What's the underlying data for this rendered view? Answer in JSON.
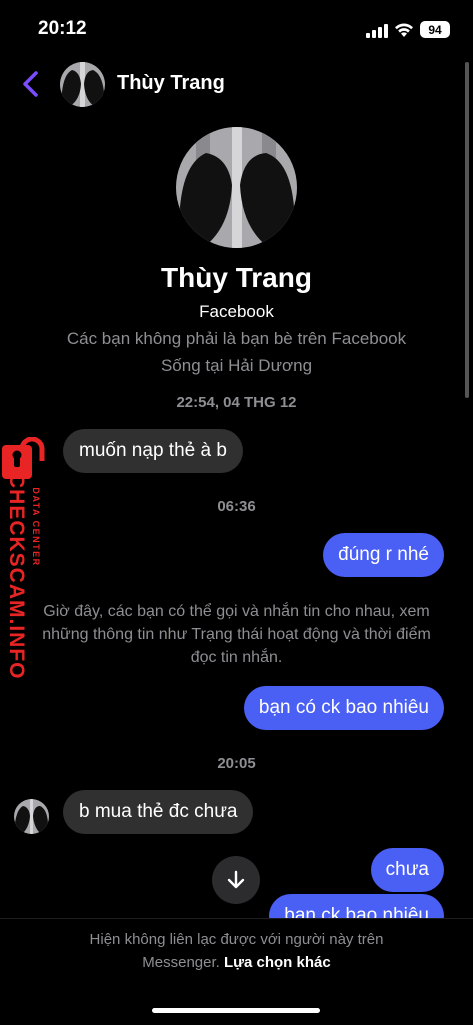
{
  "status_bar": {
    "time": "20:12",
    "battery": "94"
  },
  "header": {
    "contact_name": "Thùy Trang"
  },
  "profile": {
    "name": "Thùy Trang",
    "source": "Facebook",
    "relation": "Các bạn không phải là bạn bè trên Facebook",
    "location": "Sống tại Hải Dương"
  },
  "messages": {
    "ts1": "22:54, 04 THG 12",
    "m1": "muốn nạp thẻ à b",
    "ts2": "06:36",
    "m2": "đúng r nhé",
    "system_line1": "Giờ đây, các bạn có thể gọi và nhắn tin cho nhau, xem",
    "system_line2": "những thông tin như Trạng thái hoạt động và thời điểm",
    "system_line3": "đọc tin nhắn.",
    "m3": "bạn có ck bao nhiêu",
    "ts3": "20:05",
    "m4": "b mua thẻ đc chưa",
    "m5": "chưa",
    "m6": "bạn ck bao nhiêu"
  },
  "watermark": {
    "brand": "CHECKSCAM.INFO",
    "tag": "DATA CENTER"
  },
  "footer": {
    "line1": "Hiện không liên lạc được với người này trên",
    "line2_muted": "Messenger.",
    "line2_link": "Lựa chọn khác"
  },
  "icons": {
    "back": "chevron-left-icon",
    "scroll_down": "arrow-down-icon",
    "signal": "signal-icon",
    "wifi": "wifi-icon"
  },
  "colors": {
    "accent": "#4a5ff4",
    "back_arrow": "#7b4dff",
    "watermark": "#e82424"
  }
}
